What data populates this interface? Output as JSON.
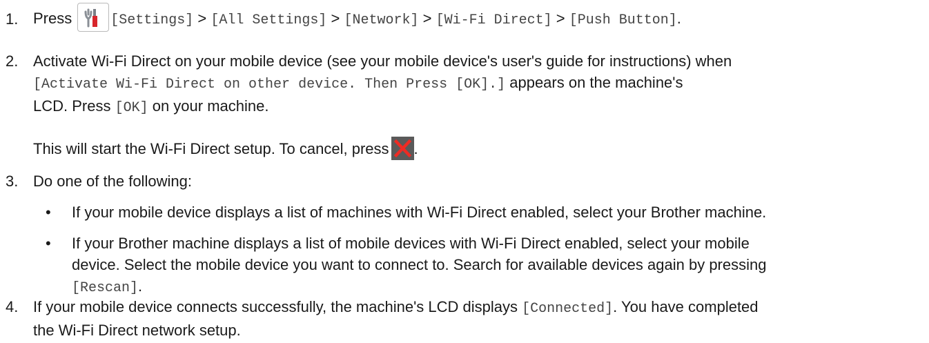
{
  "steps": [
    {
      "number": "1.",
      "press": "Press",
      "icon": "settings-icon",
      "path": [
        {
          "label": "[Settings]",
          "sep": " > "
        },
        {
          "label": "[All Settings]",
          "sep": " > "
        },
        {
          "label": "[Network]",
          "sep": " > "
        },
        {
          "label": "[Wi-Fi Direct]",
          "sep": " > "
        },
        {
          "label": "[Push Button]",
          "sep": "."
        }
      ]
    },
    {
      "number": "2.",
      "text_a": "Activate Wi-Fi Direct on your mobile device (see your mobile device's user's guide for instructions) when",
      "lcd_message": "[Activate Wi-Fi Direct on other device. Then Press [OK].]",
      "text_b": " appears on the machine's",
      "text_c": "LCD. Press ",
      "ok_label": "[OK]",
      "text_d": " on your machine.",
      "note": "This will start the Wi-Fi Direct setup. To cancel, press",
      "note_icon": "cancel-icon",
      "note_end": "."
    },
    {
      "number": "3.",
      "text": "Do one of the following:",
      "bullets": [
        {
          "dot": "•",
          "line1": "If your mobile device displays a list of machines with Wi-Fi Direct enabled, select your Brother machine."
        },
        {
          "dot": "•",
          "line1": "If your Brother machine displays a list of mobile devices with Wi-Fi Direct enabled, select your mobile",
          "line2": "device. Select the mobile device you want to connect to. Search for available devices again by pressing",
          "rescan_label": "[Rescan]",
          "line3_end": "."
        }
      ]
    },
    {
      "number": "4.",
      "text_a": "If your mobile device connects successfully, the machine's LCD displays ",
      "connected_label": "[Connected]",
      "text_b": ". You have completed",
      "text_c": "the Wi-Fi Direct network setup."
    }
  ],
  "colors": {
    "text": "#1a1a1a",
    "mono_text": "#444444",
    "settings_red": "#d8262c",
    "cancel_bg": "#5a5a5a",
    "cancel_x": "#ee2b24"
  }
}
